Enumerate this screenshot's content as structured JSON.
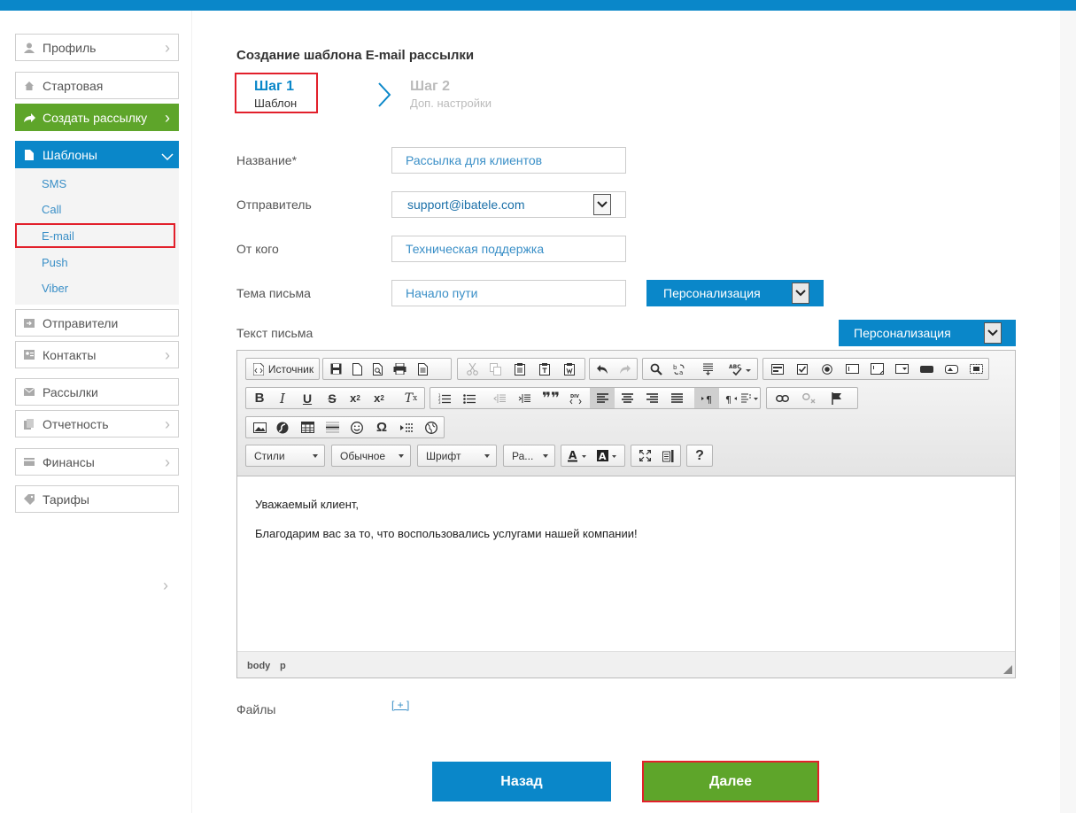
{
  "sidebar": {
    "items": [
      {
        "label": "Профиль",
        "icon": "user-icon"
      },
      {
        "label": "Стартовая",
        "icon": "home-icon"
      },
      {
        "label": "Создать рассылку",
        "icon": "share-arrow-icon"
      },
      {
        "label": "Шаблоны",
        "icon": "document-icon"
      },
      {
        "label": "Отправители",
        "icon": "sender-icon"
      },
      {
        "label": "Контакты",
        "icon": "contacts-icon"
      },
      {
        "label": "Рассылки",
        "icon": "mail-icon"
      },
      {
        "label": "Отчетность",
        "icon": "report-icon"
      },
      {
        "label": "Финансы",
        "icon": "wallet-icon"
      },
      {
        "label": "Тарифы",
        "icon": "tag-icon"
      }
    ],
    "templates_sub": [
      "SMS",
      "Call",
      "E-mail",
      "Push",
      "Viber"
    ]
  },
  "page": {
    "title": "Создание шаблона E-mail рассылки",
    "step1_title": "Шаг 1",
    "step1_sub": "Шаблон",
    "step2_title": "Шаг 2",
    "step2_sub": "Доп. настройки"
  },
  "form": {
    "name_label": "Название*",
    "name_value": "Рассылка для клиентов",
    "sender_label": "Отправитель",
    "sender_value": "support@ibatele.com",
    "from_label": "От кого",
    "from_value": "Техническая поддержка",
    "subject_label": "Тема письма",
    "subject_value": "Начало пути",
    "personalize_label": "Персонализация",
    "body_label": "Текст письма",
    "personalize2_label": "Персонализация",
    "files_label": "Файлы",
    "files_add": "[ + ]"
  },
  "editor": {
    "source_label": "Источник",
    "styles": "Стили",
    "format": "Обычное",
    "font": "Шрифт",
    "size": "Ра...",
    "paragraph1": "Уважаемый клиент,",
    "paragraph2": "Благодарим вас за то, что воспользовались услугами нашей компании!",
    "path_body": "body",
    "path_p": "p"
  },
  "buttons": {
    "back": "Назад",
    "next": "Далее"
  },
  "colors": {
    "accent": "#0a87c9",
    "green": "#5ea52a",
    "highlight": "#e2202b"
  }
}
